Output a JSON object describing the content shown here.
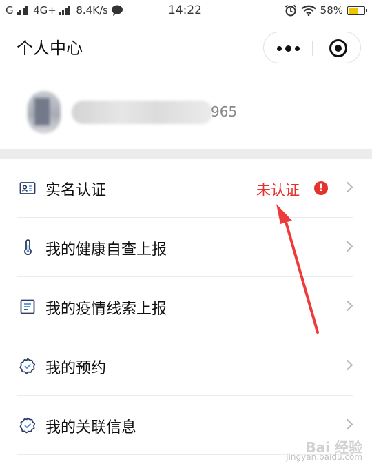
{
  "status_bar": {
    "carrier": "G",
    "network": "4G+",
    "speed": "8.4K/s",
    "time": "14:22",
    "battery_percent": "58%",
    "battery_level": 0.58,
    "battery_color": "#f2c400"
  },
  "nav": {
    "title": "个人中心",
    "more_icon": "more-dots-icon",
    "close_icon": "target-circle-icon"
  },
  "profile": {
    "phone_suffix": "965"
  },
  "menu": {
    "items": [
      {
        "label": "实名认证",
        "icon": "id-card-icon",
        "status": "未认证",
        "status_icon": "alert-icon"
      },
      {
        "label": "我的健康自查上报",
        "icon": "thermometer-icon"
      },
      {
        "label": "我的疫情线索上报",
        "icon": "document-lines-icon"
      },
      {
        "label": "我的预约",
        "icon": "badge-check-icon"
      },
      {
        "label": "我的关联信息",
        "icon": "badge-check-icon"
      }
    ]
  },
  "colors": {
    "alert_red": "#e5322d",
    "icon_blue": "#2c3e66"
  },
  "watermark": {
    "brand": "Bai 经验",
    "url": "jingyan.baidu.com"
  }
}
